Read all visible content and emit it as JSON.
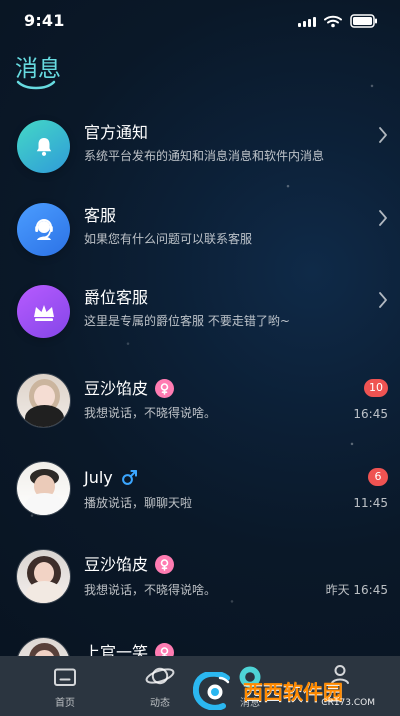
{
  "status": {
    "time": "9:41"
  },
  "page": {
    "title": "消息"
  },
  "messages": {
    "service_items": [
      {
        "title": "官方通知",
        "desc": "系统平台发布的通知和消息消息和软件内消息",
        "icon": "bell-icon",
        "color_start": "#44d8c6",
        "color_end": "#2f9bd9"
      },
      {
        "title": "客服",
        "desc": "如果您有什么问题可以联系客服",
        "icon": "headset-icon",
        "color_start": "#4b9dff",
        "color_end": "#2c72e6"
      },
      {
        "title": "爵位客服",
        "desc": "这里是专属的爵位客服 不要走错了哟~",
        "icon": "crown-icon",
        "color_start": "#b75bff",
        "color_end": "#8446e8"
      }
    ],
    "chats": [
      {
        "name": "豆沙馅皮",
        "gender_icon": "female-icon",
        "preview": "我想说话，不晓得说啥。",
        "badge": "10",
        "time": "16:45"
      },
      {
        "name": "July",
        "gender_icon": "male-icon",
        "preview": "播放说话，聊聊天啦",
        "badge": "6",
        "time": "11:45"
      },
      {
        "name": "豆沙馅皮",
        "gender_icon": "female-icon",
        "preview": "我想说话，不晓得说啥。",
        "badge": "",
        "time": "昨天 16:45"
      },
      {
        "name": "上官一笑",
        "gender_icon": "female-icon",
        "preview": "",
        "badge": "",
        "time": ""
      }
    ]
  },
  "tabs": [
    {
      "label": "首页",
      "icon": "home-icon"
    },
    {
      "label": "动态",
      "icon": "planet-icon"
    },
    {
      "label": "消息",
      "icon": "message-icon"
    },
    {
      "label": "",
      "icon": "profile-icon"
    }
  ],
  "watermark": {
    "text": "西西软件园",
    "url": "CR173.COM"
  },
  "colors": {
    "accent": "#67dbe0",
    "badge": "#ef5352",
    "female": "#ff7cb2",
    "male": "#3ba6ff",
    "tabbar": "#2b3540"
  }
}
